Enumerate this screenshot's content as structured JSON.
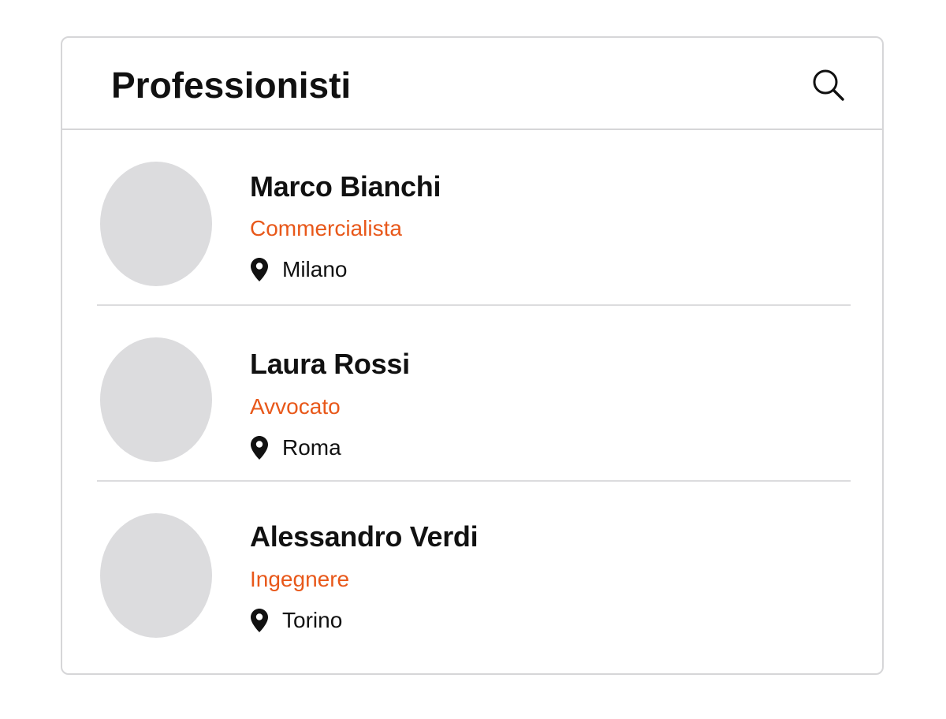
{
  "header": {
    "title": "Professionisti",
    "search_icon": "search-icon"
  },
  "professionals": [
    {
      "name": "Marco Bianchi",
      "profession": "Commercialista",
      "city": "Milano",
      "location_icon": "map-pin-icon"
    },
    {
      "name": "Laura Rossi",
      "profession": "Avvocato",
      "city": "Roma",
      "location_icon": "map-pin-icon"
    },
    {
      "name": "Alessandro Verdi",
      "profession": "Ingegnere",
      "city": "Torino",
      "location_icon": "map-pin-icon"
    }
  ],
  "colors": {
    "accent": "#e8581a",
    "text": "#111111",
    "avatar_placeholder": "#dcdcde",
    "divider": "#d6d6d8"
  }
}
